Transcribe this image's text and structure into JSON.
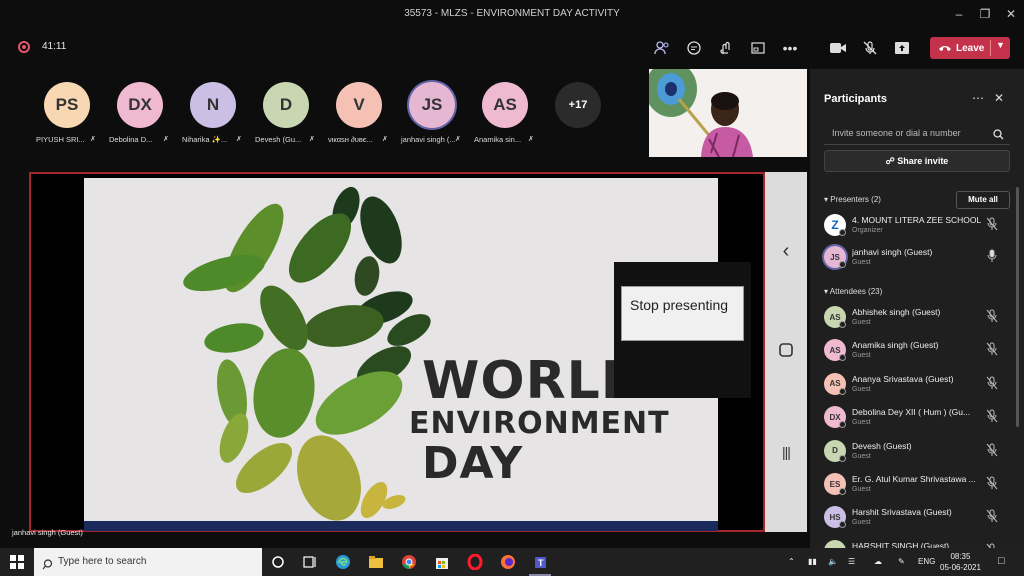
{
  "window": {
    "title": "35573 - MLZS - ENVIRONMENT DAY ACTIVITY"
  },
  "call": {
    "timer": "41:11",
    "leave_label": "Leave"
  },
  "colors": {
    "accent": "#6264a7",
    "leave": "#c4314b",
    "border_red": "#a4262c"
  },
  "avatars": [
    {
      "initials": "PS",
      "name": "PIYUSH SRI...",
      "color": "#f7d8b3"
    },
    {
      "initials": "DX",
      "name": "Debolina D...",
      "color": "#efb9cf"
    },
    {
      "initials": "N",
      "name": "Niharika ✨...",
      "color": "#cbbfe5"
    },
    {
      "initials": "D",
      "name": "Devesh (Gu...",
      "color": "#c8d6b2"
    },
    {
      "initials": "V",
      "name": "νιкαѕн ∂υвє...",
      "color": "#f5c1b5"
    },
    {
      "initials": "JS",
      "name": "janhavi singh (...",
      "color": "#e6b7d2"
    },
    {
      "initials": "AS",
      "name": "Anamika sin...",
      "color": "#efb9cf"
    },
    {
      "initials": "+17",
      "name": "",
      "color": "#2b2b2b"
    }
  ],
  "slide": {
    "line1": "WORLD",
    "line2": "ENVIRONMENT",
    "line3": "DAY"
  },
  "stop_presenting": "Stop presenting",
  "presenter_caption": "janhavi singh (Guest)",
  "panel": {
    "title": "Participants",
    "invite_placeholder": "Invite someone or dial a number",
    "share_invite": "Share invite",
    "presenters_header": "Presenters (2)",
    "mute_all": "Mute all",
    "attendees_header": "Attendees (23)",
    "presenters": [
      {
        "initials": "Z",
        "name": "4. MOUNT LITERA ZEE SCHOOL",
        "role": "Organizer",
        "color": "#ffffff"
      },
      {
        "initials": "JS",
        "name": "janhavi singh (Guest)",
        "role": "Guest",
        "color": "#e6b7d2"
      }
    ],
    "attendees": [
      {
        "initials": "AS",
        "name": "Abhishek singh (Guest)",
        "role": "Guest",
        "color": "#c8d6b2"
      },
      {
        "initials": "AS",
        "name": "Anamika singh (Guest)",
        "role": "Guest",
        "color": "#efb9cf"
      },
      {
        "initials": "AS",
        "name": "Ananya Srivastava (Guest)",
        "role": "Guest",
        "color": "#f5c1b5"
      },
      {
        "initials": "DX",
        "name": "Debolina Dey XII ( Hum ) (Gu...",
        "role": "Guest",
        "color": "#efb9cf"
      },
      {
        "initials": "D",
        "name": "Devesh (Guest)",
        "role": "Guest",
        "color": "#c8d6b2"
      },
      {
        "initials": "ES",
        "name": "Er. G. Atul Kumar Shrivastawa ...",
        "role": "Guest",
        "color": "#f5c1b5"
      },
      {
        "initials": "HS",
        "name": "Harshit Srivastava (Guest)",
        "role": "Guest",
        "color": "#cbbfe5"
      },
      {
        "initials": "",
        "name": "HARSHIT SINGH (Guest)",
        "role": "",
        "color": "#c8d6b2"
      }
    ]
  },
  "taskbar": {
    "search_placeholder": "Type here to search",
    "lang": "ENG",
    "time": "08:35",
    "date": "05-06-2021"
  }
}
